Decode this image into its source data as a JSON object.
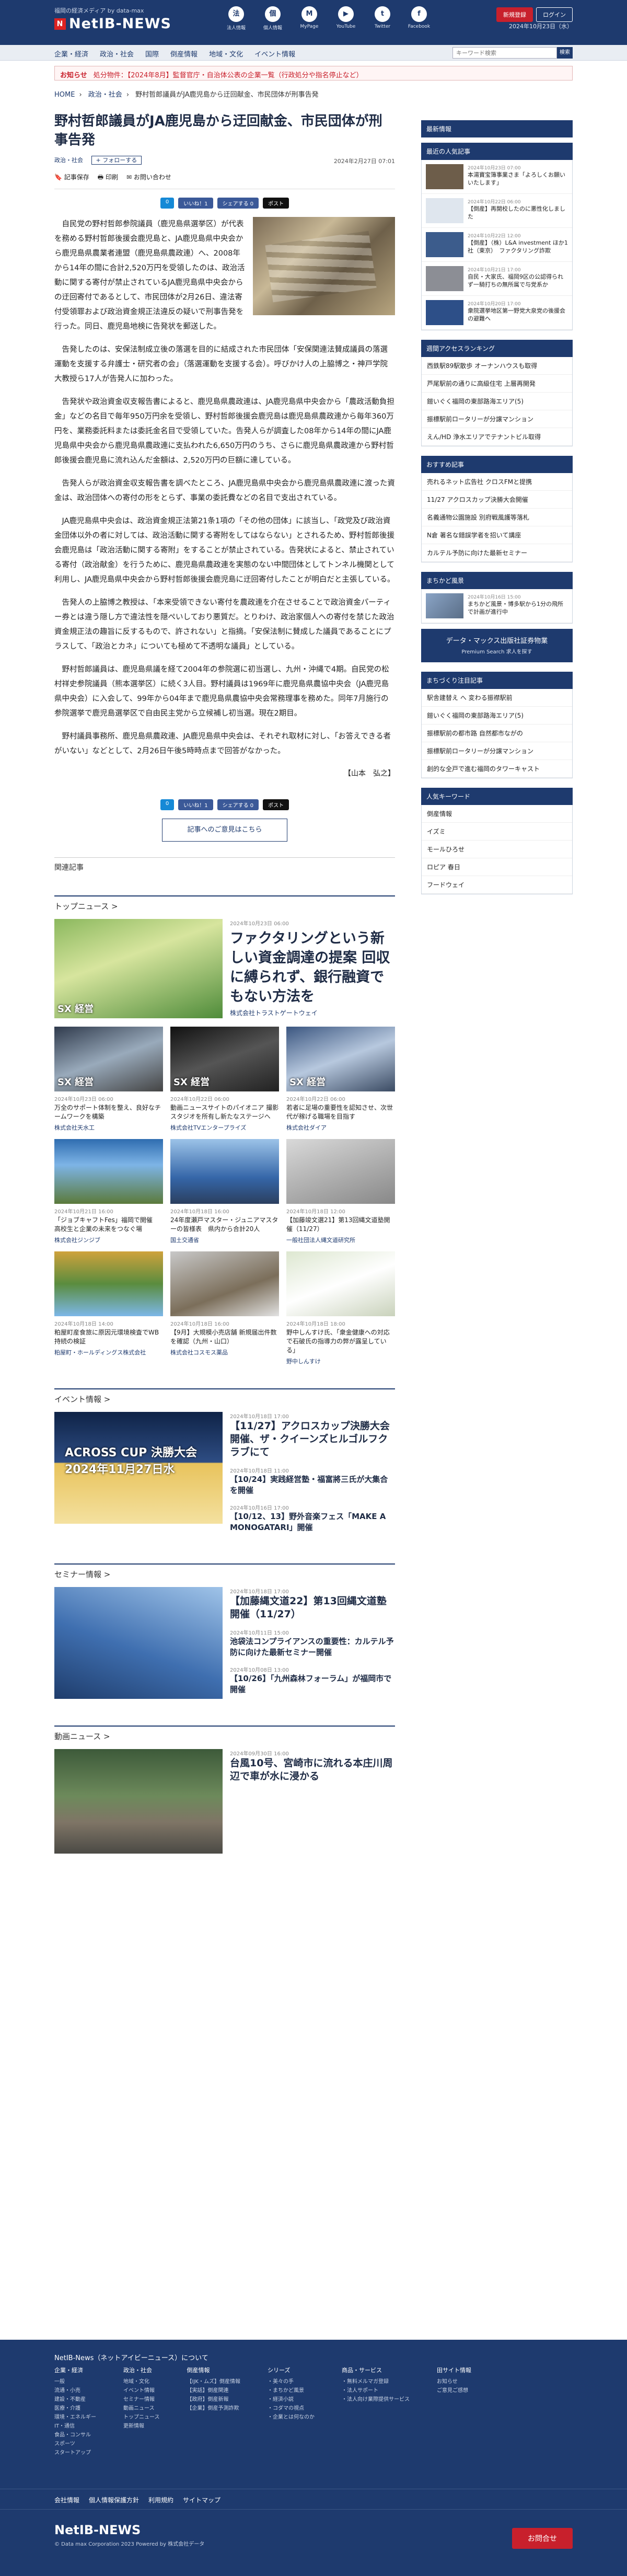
{
  "header": {
    "tagline": "福岡の経済メディア by data-max",
    "logo": "NetIB-NEWS",
    "icons": [
      {
        "label": "法人情報",
        "g": "法"
      },
      {
        "label": "個人情報",
        "g": "個"
      },
      {
        "label": "MyPage",
        "g": "M"
      },
      {
        "label": "YouTube",
        "g": "▶"
      },
      {
        "label": "Twitter",
        "g": "t"
      },
      {
        "label": "Facebook",
        "g": "f"
      }
    ],
    "btn_register": "新規登録",
    "btn_login": "ログイン",
    "date": "2024年10月23日（水）"
  },
  "nav": {
    "items": [
      "企業・経済",
      "政治・社会",
      "国際",
      "倒産情報",
      "地域・文化",
      "イベント情報"
    ],
    "search_placeholder": "キーワード検索",
    "search_btn": "検索"
  },
  "alert": {
    "label": "お知らせ",
    "text": "処分物件：【2024年8月】監督官庁・自治体公表の企業一覧（行政処分や指名停止など）"
  },
  "breadcrumb": [
    "HOME",
    "政治・社会",
    "野村哲郎議員がJA鹿児島から迂回献金、市民団体が刑事告発"
  ],
  "article": {
    "title": "野村哲郎議員がJA鹿児島から迂回献金、市民団体が刑事告発",
    "category": "政治・社会",
    "follow": "+ フォローする",
    "date": "2024年2月27日 07:01",
    "tools": [
      "記事保存",
      "印刷",
      "お問い合わせ"
    ],
    "share": [
      "0",
      "いいね！1",
      "シェアする 0",
      "ポスト"
    ],
    "paragraphs": [
      "自民党の野村哲郎参院議員（鹿児島県選挙区）が代表を務める野村哲郎後援会鹿児島と、JA鹿児島県中央会から鹿児島県農業者連盟（鹿児島県農政連）へ、2008年から14年の間に合計2,520万円を受領したのは、政治活動に関する寄付が禁止されているJA鹿児島県中央会からの迂回寄付であるとして、市民団体が2月26日、違法寄付受領罪および政治資金規正法違反の疑いで刑事告発を行った。同日、鹿児島地検に告発状を郵送した。",
      "告発したのは、安保法制成立後の落選を目的に結成された市民団体「安保関連法賛成議員の落選運動を支援する弁護士・研究者の会」（落選運動を支援する会）。呼びかけ人の上脇博之・神戸学院大教授ら17人が告発人に加わった。",
      "告発状や政治資金収支報告書によると、鹿児島県農政連は、JA鹿児島県中央会から「農政活動負担金」などの名目で毎年950万円余を受領し、野村哲郎後援会鹿児島は鹿児島県農政連から毎年360万円を、業務委託料または委託金名目で受領していた。告発人らが調査した08年から14年の間にJA鹿児島県中央会から鹿児島県農政連に支払われた6,650万円のうち、さらに鹿児島県農政連から野村哲郎後援会鹿児島に流れ込んだ金額は、2,520万円の巨額に達している。",
      "告発人らが政治資金収支報告書を調べたところ、JA鹿児島県中央会から鹿児島県農政連に渡った資金は、政治団体への寄付の形をとらず、事業の委託費などの名目で支出されている。",
      "JA鹿児島県中央会は、政治資金規正法第21条1項の「その他の団体」に該当し、「政党及び政治資金団体以外の者に対しては、政治活動に関する寄附をしてはならない」とされるため、野村哲郎後援会鹿児島は「政治活動に関する寄附」をすることが禁止されている。告発状によると、禁止されている寄付（政治献金）を行うために、鹿児島県農政連を実態のない中間団体としてトンネル機関として利用し、JA鹿児島県中央会から野村哲郎後援会鹿児島に迂回寄付したことが明白だと主張している。",
      "告発人の上脇博之教授は、「本来受領できない寄付を農政連を介在させることで政治資金パーティー券とは違う隠し方で違法性を隠ぺいしており悪質だ。とりわけ、政治家個人への寄付を禁じた政治資金規正法の趣旨に反するもので、許されない」と指摘。「安保法制に賛成した議員であることにプラスして、「政治とカネ」についても極めて不透明な議員」としている。",
      "野村哲郎議員は、鹿児島県議を経て2004年の参院選に初当選し、九州・沖縄で4期。自民党の松村祥史参院議員（熊本選挙区）に続く3人目。野村議員は1969年に鹿児島県農協中央会（JA鹿児島県中央会）に入会して、99年から04年まで鹿児島県農協中央会常務理事を務めた。同年7月施行の参院選挙で鹿児島選挙区で自由民主党から立候補し初当選。現在2期目。",
      "野村議員事務所、鹿児島県農政連、JA鹿児島県中央会は、それぞれ取材に対し、「お答えできる者がいない」などとして、2月26日午後5時時点まで回答がなかった。"
    ],
    "signature": "【山本　弘之】",
    "cta": "記事へのご意見はこちら"
  },
  "related": {
    "title": "関連記事",
    "top_news": {
      "title": "トップニュース >",
      "feature": {
        "date": "2024年10月23日 06:00",
        "title": "ファクタリングという新しい資金調達の提案 回収に縛られず、銀行融資でもない方法を",
        "company": "株式会社トラストゲートウェイ",
        "img": "SX 経営"
      },
      "cards": [
        {
          "date": "2024年10月23日 06:00",
          "title": "万全のサポート体制を整え、良好なチームワークを構築",
          "company": "株式会社天水工",
          "img": "SX 経営"
        },
        {
          "date": "2024年10月22日 06:00",
          "title": "動画ニュースサイトのパイオニア 撮影スタジオを所有し新たなステージへ",
          "company": "株式会社TVエンタープライズ",
          "img": "SX 経営"
        },
        {
          "date": "2024年10月22日 06:00",
          "title": "若者に足場の重要性を認知させ、次世代が稼げる職場を目指す",
          "company": "株式会社ダイア",
          "img": "SX 経営"
        },
        {
          "date": "2024年10月21日 16:00",
          "title": "「ジョブキャフトFes」福岡で開催　高校生と企業の未来をつなぐ場",
          "company": "株式会社ジンジブ",
          "img": ""
        },
        {
          "date": "2024年10月18日 16:00",
          "title": "24年度瀬戸マスター・ジュニアマスターの皆様表　県内から合計20人",
          "company": "国土交通省",
          "img": ""
        },
        {
          "date": "2024年10月18日 12:00",
          "title": "【加藤竣文選21】第13回縄文道塾開催（11/27）",
          "company": "一般社団法人縄文道研究所",
          "img": ""
        },
        {
          "date": "2024年10月18日 14:00",
          "title": "粕屋町産食旅に原因元環境検査でWB持続の検証",
          "company": "粕屋町・ホールディングス株式会社",
          "img": ""
        },
        {
          "date": "2024年10月18日 16:00",
          "title": "【9月】大規模小売店舗 新規届出件数を確認（九州・山口）",
          "company": "株式会社コスモス薬品",
          "img": ""
        },
        {
          "date": "2024年10月18日 18:00",
          "title": "野中しんすけ氏、「衆金健康への対応で石破氏の指導力の弊が露呈している」",
          "company": "野中しんすけ",
          "img": ""
        }
      ]
    },
    "events": {
      "title": "イベント情報 >",
      "img": "ACROSS CUP 決勝大会 2024年11月27日水",
      "items": [
        {
          "date": "2024年10月18日 17:00",
          "title": "【11/27】アクロスカップ決勝大会開催、ザ・クイーンズヒルゴルフクラブにて",
          "big": true
        },
        {
          "date": "2024年10月18日 11:00",
          "title": "【10/24】実践経営塾・福富將三氏が大集合を開催",
          "big": false
        },
        {
          "date": "2024年10月16日 17:00",
          "title": "【10/12、13】野外音楽フェス「MAKE A MONOGATARI」開催",
          "big": false
        }
      ]
    },
    "seminar": {
      "title": "セミナー情報 >",
      "items": [
        {
          "date": "2024年10月18日 17:00",
          "title": "【加藤縄文道22】第13回縄文道塾開催（11/27）",
          "big": true
        },
        {
          "date": "2024年10月11日 15:00",
          "title": "池袋法コンプライアンスの重要性：カルテル予防に向けた最新セミナー開催",
          "big": false
        },
        {
          "date": "2024年10月08日 13:00",
          "title": "【10/26】「九州森林フォーラム」が福岡市で開催",
          "big": false
        }
      ]
    },
    "video": {
      "title": "動画ニュース >",
      "items": [
        {
          "date": "2024年09月30日 16:00",
          "title": "台風10号、宮崎市に流れる本庄川周辺で車が水に浸かる",
          "big": true
        }
      ]
    }
  },
  "sidebar": {
    "news_title": "最新情報",
    "latest_title": "最近の人気記事",
    "latest": [
      {
        "date": "2024年10月23日 07:00",
        "title": "本湯寶宝簿事業さま「よろしくお願いいたします」"
      },
      {
        "date": "2024年10月22日 06:00",
        "title": "【倒産】再開校したのに悪性化しました"
      },
      {
        "date": "2024年10月22日 12:00",
        "title": "【倒産】（株）L&A investment ほか1社（東京）　ファクタリング詐欺"
      },
      {
        "date": "2024年10月21日 17:00",
        "title": "自民・大家氏、福岡9区の公認得られず一騎打ちの無所属で与党系か"
      },
      {
        "date": "2024年10月20日 17:00",
        "title": "衆院選挙地区第一野党大泉党の後援会の避難へ"
      }
    ],
    "access_title": "週間アクセスランキング",
    "access": [
      "西鉄駅89駅散歩 オーナンハウスも取得",
      "芦尾駅前の通りに高級住宅 上層再開発",
      "鎧いぐく福岡の東部路海エリア(5)",
      "振標駅前ロータリーが分譲マンション",
      "えん/HD 浄水エリアでテナントビル取得"
    ],
    "recommend_title": "おすすめ記事",
    "recommend": [
      "売れるネット広告社 クロスFMと提携",
      "11/27 アクロスカップ決勝大会開催",
      "名義通物公園施設 別府戦風護等落札",
      "N倉 著名な錯誤学者を招いて講座",
      "カルテル予防に向けた最新セミナー"
    ],
    "pickup_title": "まちかど風景",
    "pickup": {
      "date": "2024年10月16日 15:00",
      "title": "まちかど風景・博多駅から1分の飛所で計画が進行中"
    },
    "ad": {
      "title": "データ・マックス出版社証券物業",
      "sub": "Premium Search 求人を探す"
    },
    "local_title": "まちづくり注目記事",
    "local": [
      "駅舎建替え へ 変わる振襟駅前",
      "鎧いぐく福岡の東部路海エリア(5)",
      "振標駅前の都市路 自然都市ながの",
      "振標駅前ロータリーが分譲マンション",
      "創的な全戸で進む福岡のタワーキャスト"
    ],
    "keywords_title": "人気キーワード",
    "keywords": [
      "倒産情報",
      "イズミ",
      "モールひろせ",
      "ロピア 春日",
      "フードウェイ"
    ]
  },
  "footer": {
    "title": "NetIB-News（ネットアイビーニュース）について",
    "cols": [
      {
        "h": "企業・経済",
        "l": [
          "一般",
          "流通・小売",
          "建設・不動産",
          "医療・介護",
          "環境・エネルギー",
          "IT・通信",
          "食品・コンサル",
          "スポーツ",
          "スタートアップ"
        ]
      },
      {
        "h": "政治・社会",
        "l": [
          "地域・文化",
          "イベント情報",
          "セミナー情報",
          "動画ニュース",
          "トップニュース",
          "更新情報"
        ]
      },
      {
        "h": "倒産情報",
        "l": [
          "【IJK・ムズ】倒産情報",
          "【実話】倒産関連",
          "【政府】倒産新報",
          "【企業】倒産予測詐欺"
        ]
      },
      {
        "h": "シリーズ",
        "l": [
          "・美々の手",
          "・まちかど風景",
          "・経済小説",
          "・コダマの視点",
          "・企業とは何なのか"
        ]
      },
      {
        "h": "商品・サービス",
        "l": [
          "・無料メルマガ登録",
          "・法人サポート",
          "・法人向け業際提供サービス"
        ]
      },
      {
        "h": "田サイト情報",
        "l": [
          "お知らせ",
          "ご意見ご感想"
        ]
      }
    ],
    "links": [
      "会社情報",
      "個人情報保護方針",
      "利用規約",
      "サイトマップ"
    ],
    "logo": "NetIB-NEWS",
    "copyright": "© Data max Corporation 2023 Powered by 株式会社データ",
    "btn": "お問合せ"
  }
}
